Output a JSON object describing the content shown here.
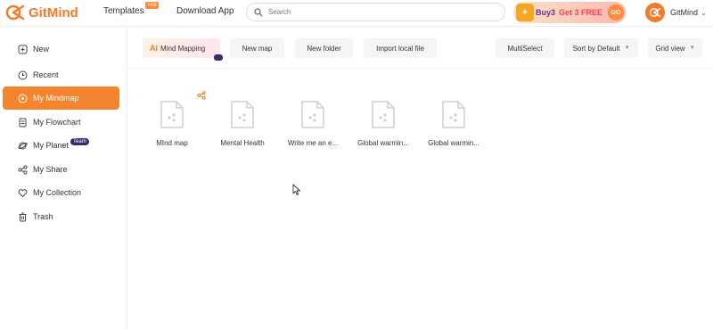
{
  "header": {
    "logo_text": "GitMind",
    "nav_templates": "Templates",
    "hot_badge": "Hot",
    "nav_download": "Download App",
    "search_placeholder": "Search",
    "promo_buy": "Buy3",
    "promo_free": "Get 3 FREE",
    "promo_go": "GO",
    "account_name": "GitMind"
  },
  "sidebar": {
    "items": [
      {
        "label": "New",
        "icon": "new-icon"
      },
      {
        "label": "Recent",
        "icon": "clock-icon"
      },
      {
        "label": "My Mindmap",
        "icon": "mindmap-icon",
        "active": true
      },
      {
        "label": "My Flowchart",
        "icon": "flowchart-icon"
      },
      {
        "label": "My Planet",
        "icon": "planet-icon",
        "badge": "Team"
      },
      {
        "label": "My Share",
        "icon": "share-icon"
      },
      {
        "label": "My Collection",
        "icon": "heart-icon"
      },
      {
        "label": "Trash",
        "icon": "trash-icon"
      }
    ]
  },
  "toolbar": {
    "ai_mark": "Ai",
    "ai_label": "Mind Mapping",
    "new_map": "New map",
    "new_folder": "New folder",
    "import_file": "Import local file",
    "multiselect": "MultiSelect",
    "sort": "Sort by Default",
    "view": "Grid view"
  },
  "files": [
    {
      "name": "MInd map",
      "shared": true
    },
    {
      "name": "Mental Health",
      "shared": false
    },
    {
      "name": "Write me an e...",
      "shared": false
    },
    {
      "name": "Global warmin...",
      "shared": false
    },
    {
      "name": "Global warmin...",
      "shared": false
    }
  ],
  "colors": {
    "accent": "#f5842f",
    "brand": "#f57a2b",
    "team_badge": "#3b2a6e"
  }
}
